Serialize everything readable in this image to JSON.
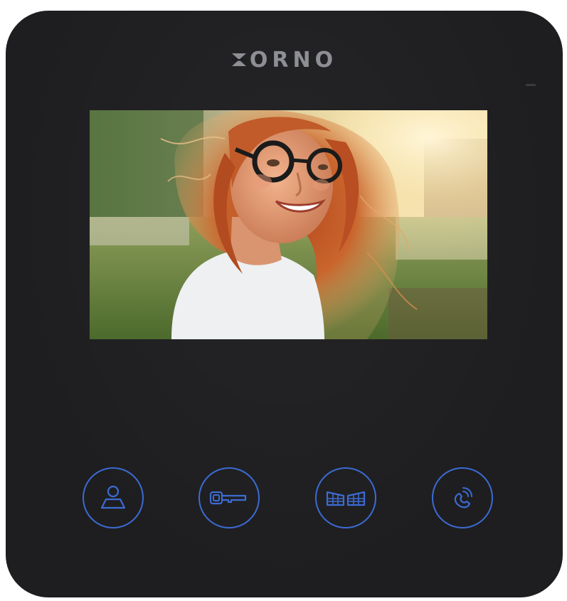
{
  "device": {
    "brand": "ORNO",
    "brand_mark_icon": "orno-logo-mark",
    "body_color": "#1e1e20",
    "accent_color": "#3c6bd4"
  },
  "screen": {
    "image_description_icon": "video-feed-photo",
    "content": "camera-feed"
  },
  "buttons": [
    {
      "icon": "user-monitor-icon"
    },
    {
      "icon": "key-unlock-icon"
    },
    {
      "icon": "gate-open-icon"
    },
    {
      "icon": "phone-call-icon"
    }
  ]
}
